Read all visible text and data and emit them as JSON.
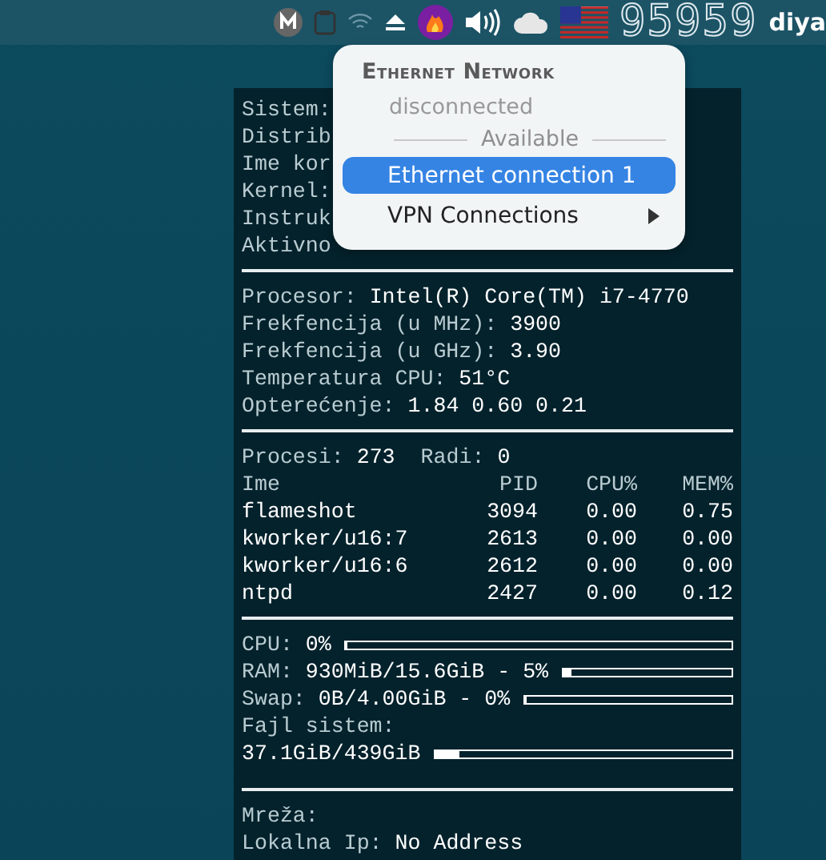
{
  "top_bar": {
    "clock": "95959",
    "user": "diya"
  },
  "network_menu": {
    "title": "Ethernet Network",
    "status": "disconnected",
    "section": "Available",
    "items": [
      {
        "label": "Ethernet connection 1",
        "selected": true,
        "kind": "item"
      },
      {
        "label": "VPN Connections",
        "selected": false,
        "kind": "submenu"
      }
    ]
  },
  "conky": {
    "system": [
      {
        "label": "Sistem:"
      },
      {
        "label": "Distrib"
      },
      {
        "label": "Ime kor"
      },
      {
        "label": "Kernel:"
      },
      {
        "label": "Instruk"
      },
      {
        "label": "Aktivno"
      }
    ],
    "cpu": [
      {
        "label": "Procesor:",
        "value": "Intel(R) Core(TM) i7-4770"
      },
      {
        "label": "Frekfencija (u MHz):",
        "value": "3900"
      },
      {
        "label": "Frekfencija (u GHz):",
        "value": "3.90"
      },
      {
        "label": "Temperatura CPU:",
        "value": "51°C"
      },
      {
        "label": "Opterećenje:",
        "value": "1.84 0.60 0.21"
      }
    ],
    "processes": {
      "label": "Procesi:",
      "count": "273",
      "running_label": "Radi:",
      "running": "0",
      "columns": [
        "Ime",
        "PID",
        "CPU%",
        "MEM%"
      ],
      "rows": [
        [
          "flameshot",
          "3094",
          "0.00",
          "0.75"
        ],
        [
          "kworker/u16:7",
          "2613",
          "0.00",
          "0.00"
        ],
        [
          "kworker/u16:6",
          "2612",
          "0.00",
          "0.00"
        ],
        [
          "ntpd",
          "2427",
          "0.00",
          "0.12"
        ]
      ]
    },
    "usage": [
      {
        "label": "CPU:",
        "value": "0%",
        "level": 0,
        "kind": "inline"
      },
      {
        "label": "RAM:",
        "value": "930MiB/15.6GiB - 5%",
        "level": 0.05,
        "kind": "inline"
      },
      {
        "label": "Swap:",
        "value": "0B/4.00GiB - 0%",
        "level": 0,
        "kind": "inline"
      },
      {
        "label": "Fajl sistem:",
        "value": "37.1GiB/439GiB",
        "level": 0.085,
        "kind": "stacked"
      }
    ],
    "network": [
      {
        "label": "Mreža:"
      },
      {
        "label": "Lokalna Ip:",
        "value": "No Address"
      }
    ]
  }
}
